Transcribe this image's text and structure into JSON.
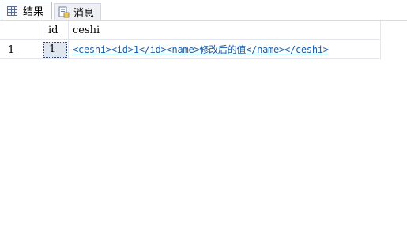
{
  "tabs": [
    {
      "label": "结果",
      "icon": "grid-icon"
    },
    {
      "label": "消息",
      "icon": "message-icon"
    }
  ],
  "grid": {
    "columns": [
      "id",
      "ceshi"
    ],
    "rows": [
      {
        "rownum": "1",
        "id": "1",
        "ceshi": "<ceshi><id>1</id><name>修改后的值</name></ceshi>"
      }
    ]
  },
  "colors": {
    "link": "#1a5fa8",
    "selected_cell": "#dfe6f0"
  }
}
